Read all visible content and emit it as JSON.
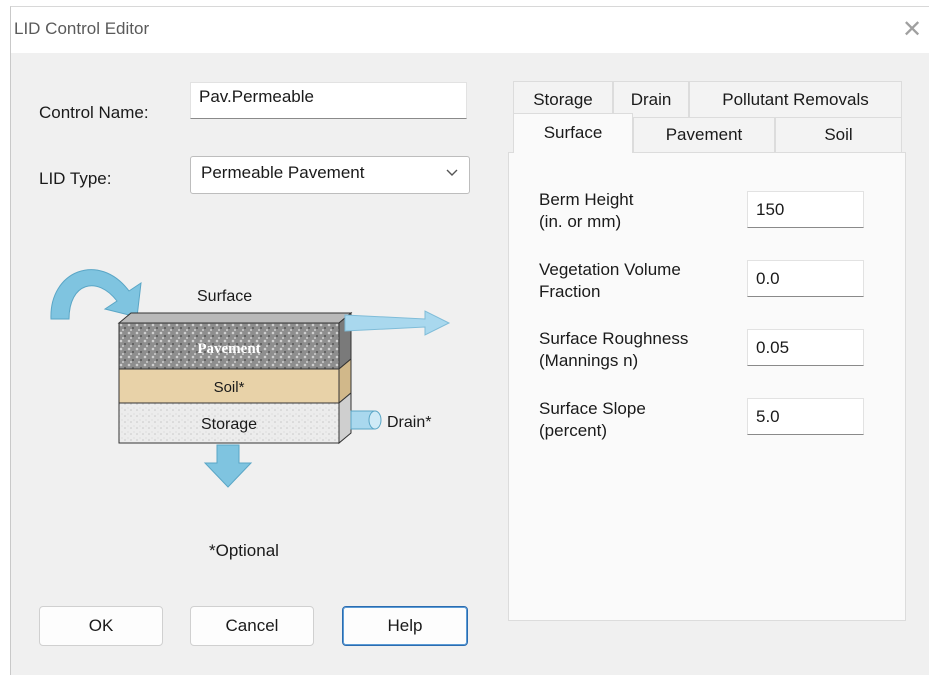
{
  "window": {
    "title": "LID Control Editor",
    "close_glyph": "✕"
  },
  "form": {
    "control_name_label": "Control Name:",
    "control_name_value": "Pav.Permeable",
    "lid_type_label": "LID Type:",
    "lid_type_value": "Permeable Pavement"
  },
  "diagram": {
    "surface": "Surface",
    "pavement": "Pavement",
    "soil": "Soil*",
    "storage": "Storage",
    "drain": "Drain*",
    "optional_note": "*Optional",
    "colors": {
      "arrow": "#7fc4e0",
      "pavement": "#9a9a9a",
      "soil": "#e8d2a8",
      "storage": "#e6e6e6"
    }
  },
  "buttons": {
    "ok": "OK",
    "cancel": "Cancel",
    "help": "Help"
  },
  "tabs": {
    "row1": [
      "Storage",
      "Drain",
      "Pollutant Removals"
    ],
    "row2": [
      "Surface",
      "Pavement",
      "Soil"
    ],
    "active": "Surface"
  },
  "surface_fields": [
    {
      "label_line1": "Berm Height",
      "label_line2": "(in. or mm)",
      "value": "150"
    },
    {
      "label_line1": "Vegetation Volume",
      "label_line2": "Fraction",
      "value": "0.0"
    },
    {
      "label_line1": "Surface Roughness",
      "label_line2": "(Mannings n)",
      "value": "0.05"
    },
    {
      "label_line1": "Surface Slope",
      "label_line2": "(percent)",
      "value": "5.0"
    }
  ]
}
